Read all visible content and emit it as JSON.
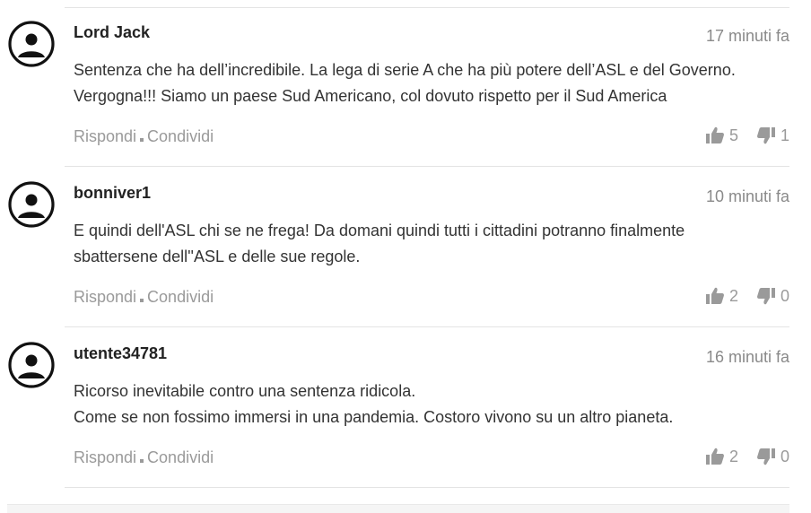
{
  "comments": [
    {
      "author": "Lord Jack",
      "time": "17 minuti fa",
      "lines": [
        "Sentenza che ha dell’incredibile. La lega di serie A che ha più potere dell’ASL e del Governo.",
        "Vergogna!!! Siamo un paese Sud Americano, col dovuto rispetto per il Sud America"
      ],
      "reply_label": "Rispondi",
      "share_label": "Condividi",
      "likes": "5",
      "dislikes": "1"
    },
    {
      "author": "bonniver1",
      "time": "10 minuti fa",
      "lines": [
        "E quindi dell'ASL chi se ne frega! Da domani quindi tutti i cittadini potranno finalmente",
        "sbattersene dell''ASL e delle sue regole."
      ],
      "reply_label": "Rispondi",
      "share_label": "Condividi",
      "likes": "2",
      "dislikes": "0"
    },
    {
      "author": "utente34781",
      "time": "16 minuti fa",
      "lines": [
        "Ricorso inevitabile contro una sentenza ridicola.",
        "Come se non fossimo immersi in una pandemia. Costoro vivono su un altro pianeta."
      ],
      "reply_label": "Rispondi",
      "share_label": "Condividi",
      "likes": "2",
      "dislikes": "0"
    }
  ],
  "colors": {
    "author": "#222222",
    "muted": "#9a9a9a",
    "divider": "#e4e4e4"
  },
  "icons": {
    "avatar": "user-avatar-icon",
    "like": "thumbs-up-icon",
    "dislike": "thumbs-down-icon"
  }
}
